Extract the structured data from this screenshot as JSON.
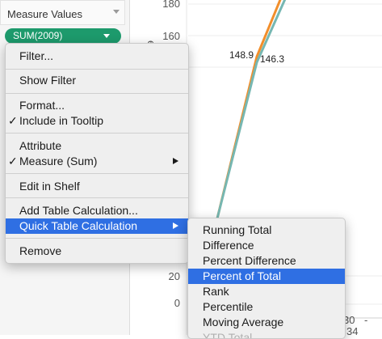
{
  "shelf": {
    "header_title": "Measure Values",
    "pill_label": "SUM(2009)"
  },
  "chart": {
    "y_ticks": [
      "180",
      "160",
      "20",
      "0"
    ],
    "x_ticks": [
      "30",
      "-",
      "34"
    ],
    "axis_fragment": "e",
    "label_left": "148.9",
    "label_right": "146.3",
    "colors": {
      "orange": "#f28e2b",
      "teal": "#76b7b2",
      "grid": "#e6e6e6"
    }
  },
  "menu": {
    "filter": "Filter...",
    "show_filter": "Show Filter",
    "format": "Format...",
    "include_tooltip": "Include in Tooltip",
    "attribute": "Attribute",
    "measure_sum": "Measure (Sum)",
    "edit_in_shelf": "Edit in Shelf",
    "add_table_calc": "Add Table Calculation...",
    "quick_table_calc": "Quick Table Calculation",
    "remove": "Remove",
    "check_mark": "✓"
  },
  "submenu": {
    "items": [
      "Running Total",
      "Difference",
      "Percent Difference",
      "Percent of Total",
      "Rank",
      "Percentile",
      "Moving Average",
      "YTD Total"
    ],
    "highlighted": "Percent of Total"
  },
  "colors": {
    "highlight": "#2f6fe3",
    "pill": "#1d9a6c"
  }
}
